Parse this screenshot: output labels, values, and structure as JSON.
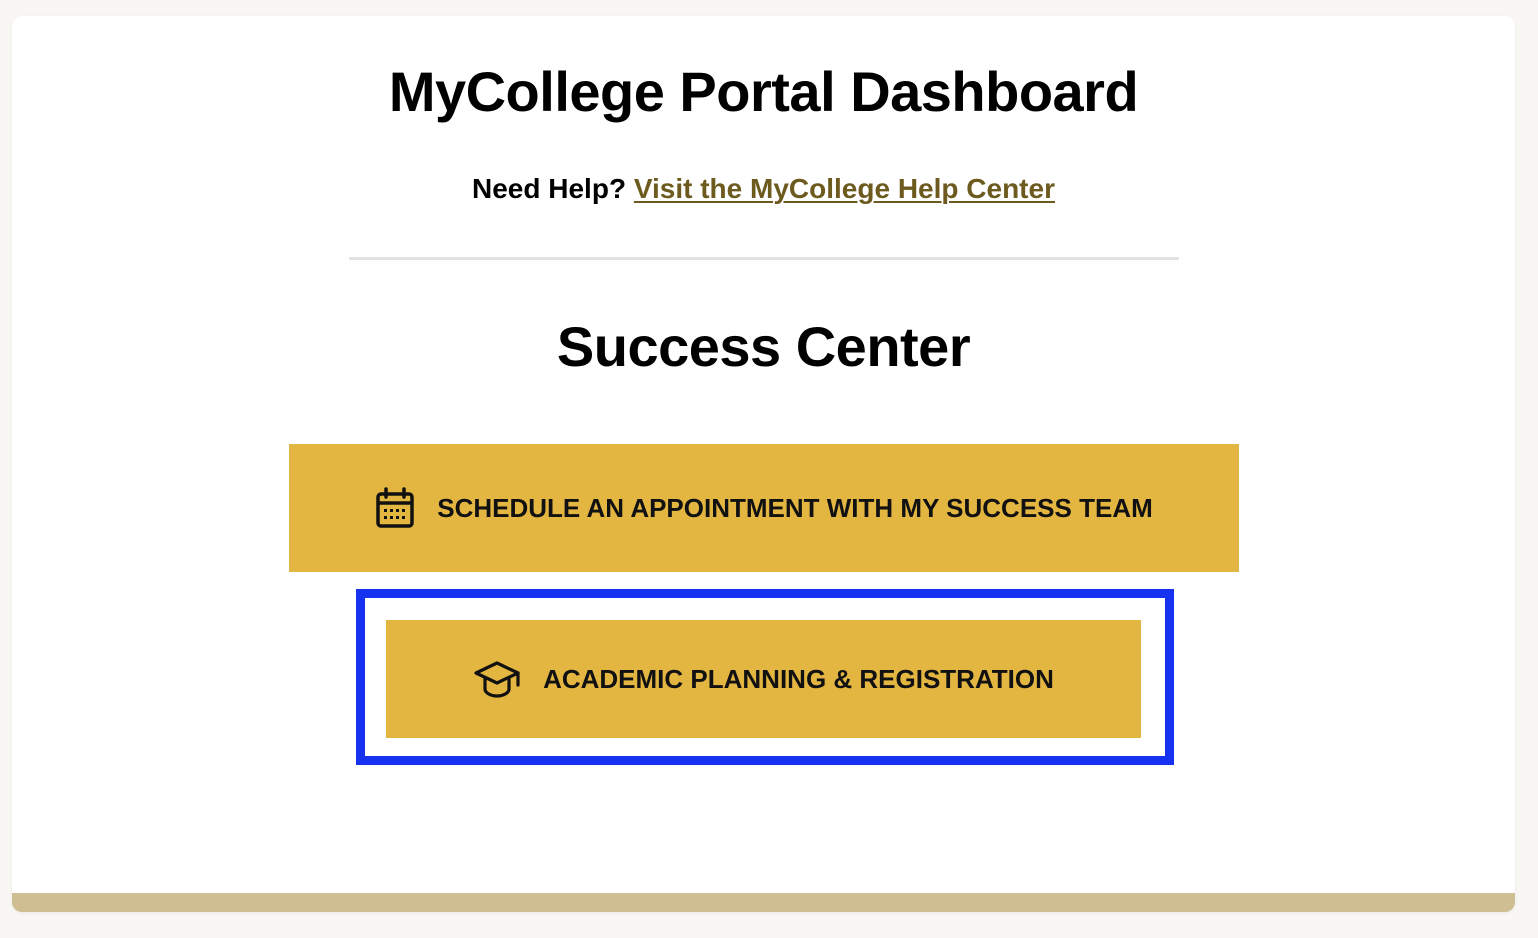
{
  "header": {
    "title": "MyCollege Portal Dashboard",
    "help_prefix": "Need Help?",
    "help_link": "Visit the MyCollege Help Center"
  },
  "success_center": {
    "title": "Success Center",
    "buttons": [
      {
        "label": "SCHEDULE AN APPOINTMENT WITH MY SUCCESS TEAM",
        "icon": "calendar-icon"
      },
      {
        "label": "ACADEMIC PLANNING & REGISTRATION",
        "icon": "graduation-cap-icon"
      }
    ]
  },
  "colors": {
    "button_bg": "#e3b541",
    "link": "#6d5a1f",
    "highlight_border": "#1432f0",
    "footer_bar": "#cfbe92"
  }
}
